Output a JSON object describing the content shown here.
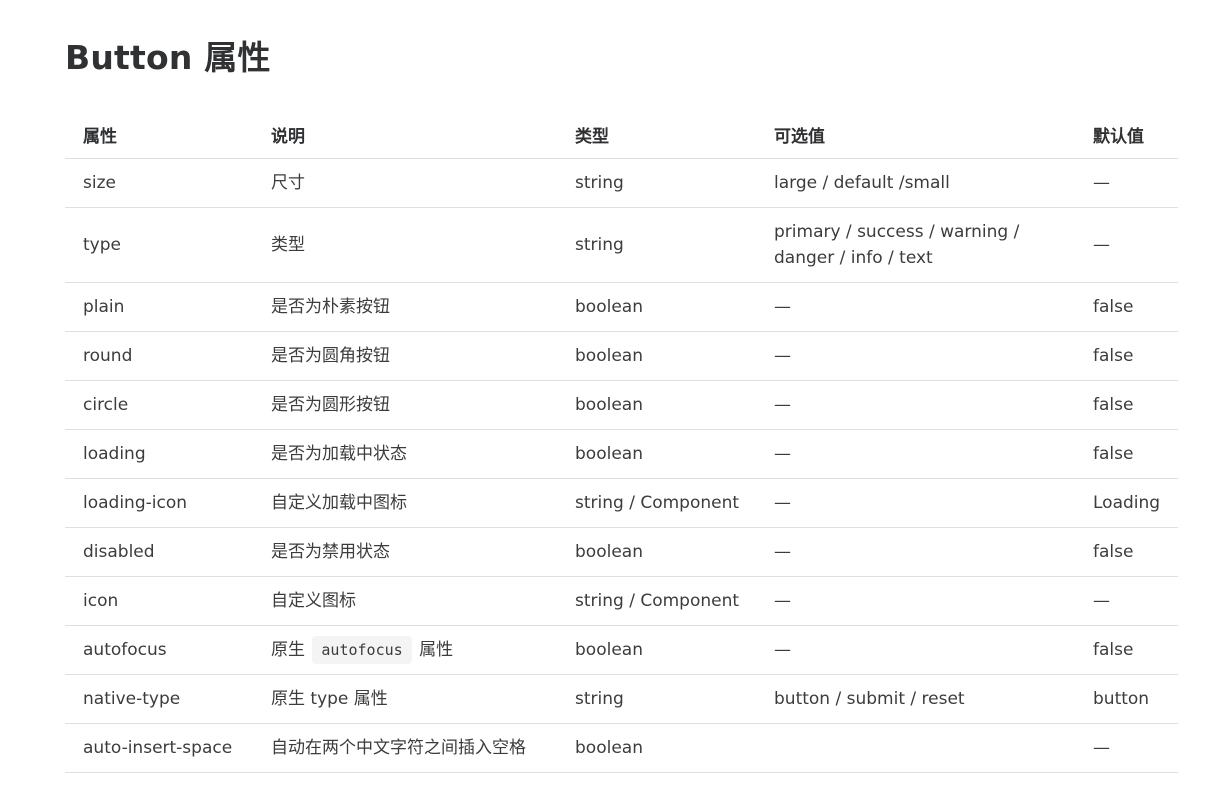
{
  "title": "Button 属性",
  "table": {
    "headers": [
      "属性",
      "说明",
      "类型",
      "可选值",
      "默认值"
    ],
    "rows": [
      {
        "attr": "size",
        "desc": "尺寸",
        "type": "string",
        "options": "large / default /small",
        "default": "—"
      },
      {
        "attr": "type",
        "desc": "类型",
        "type": "string",
        "options": "primary / success / warning / danger / info / text",
        "default": "—"
      },
      {
        "attr": "plain",
        "desc": "是否为朴素按钮",
        "type": "boolean",
        "options": "—",
        "default": "false"
      },
      {
        "attr": "round",
        "desc": "是否为圆角按钮",
        "type": "boolean",
        "options": "—",
        "default": "false"
      },
      {
        "attr": "circle",
        "desc": "是否为圆形按钮",
        "type": "boolean",
        "options": "—",
        "default": "false"
      },
      {
        "attr": "loading",
        "desc": "是否为加载中状态",
        "type": "boolean",
        "options": "—",
        "default": "false"
      },
      {
        "attr": "loading-icon",
        "desc": "自定义加载中图标",
        "type": "string / Component",
        "options": "—",
        "default": "Loading"
      },
      {
        "attr": "disabled",
        "desc": "是否为禁用状态",
        "type": "boolean",
        "options": "—",
        "default": "false"
      },
      {
        "attr": "icon",
        "desc": "自定义图标",
        "type": "string / Component",
        "options": "—",
        "default": "—"
      },
      {
        "attr": "autofocus",
        "desc_prefix": "原生",
        "desc_code": "autofocus",
        "desc_suffix": "属性",
        "type": "boolean",
        "options": "—",
        "default": "false"
      },
      {
        "attr": "native-type",
        "desc": "原生 type 属性",
        "type": "string",
        "options": "button / submit / reset",
        "default": "button"
      },
      {
        "attr": "auto-insert-space",
        "desc": "自动在两个中文字符之间插入空格",
        "type": "boolean",
        "options": "",
        "default": "—"
      }
    ]
  }
}
